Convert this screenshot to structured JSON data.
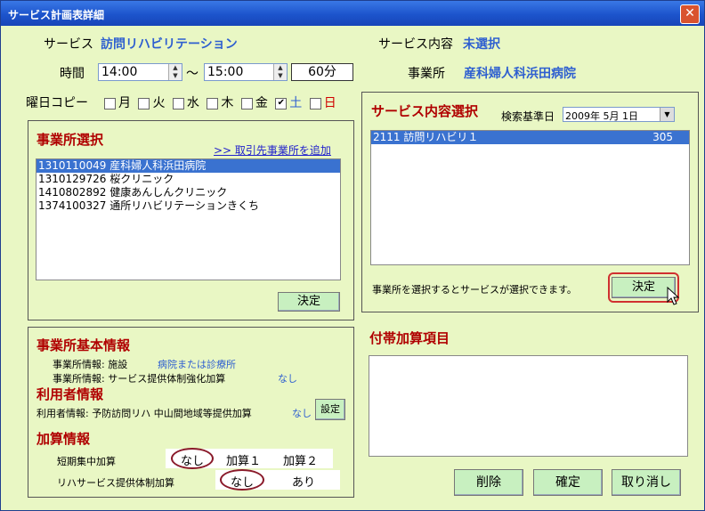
{
  "window": {
    "title": "サービス計画表詳細",
    "close_glyph": "✕"
  },
  "header": {
    "service_label": "サービス",
    "service_value": "訪問リハビリテーション",
    "content_label": "サービス内容",
    "content_value": "未選択",
    "time_label": "時間",
    "time_start": "14:00",
    "time_sep": "〜",
    "time_end": "15:00",
    "duration": "60分",
    "office_label": "事業所",
    "office_value": "産科婦人科浜田病院"
  },
  "weekday": {
    "label": "曜日コピー",
    "days": [
      {
        "label": "月",
        "checked": false,
        "color": "#000000"
      },
      {
        "label": "火",
        "checked": false,
        "color": "#000000"
      },
      {
        "label": "水",
        "checked": false,
        "color": "#000000"
      },
      {
        "label": "木",
        "checked": false,
        "color": "#000000"
      },
      {
        "label": "金",
        "checked": false,
        "color": "#000000"
      },
      {
        "label": "土",
        "checked": true,
        "color": "#2e5fd0"
      },
      {
        "label": "日",
        "checked": false,
        "color": "#d00000"
      }
    ]
  },
  "office_select": {
    "title": "事業所選択",
    "add_link": ">> 取引先事業所を追加",
    "items": [
      {
        "code": "1310110049",
        "name": "産科婦人科浜田病院",
        "selected": true
      },
      {
        "code": "1310129726",
        "name": "桜クリニック",
        "selected": false
      },
      {
        "code": "1410802892",
        "name": "健康あんしんクリニック",
        "selected": false
      },
      {
        "code": "1374100327",
        "name": "通所リハビリテーションきくち",
        "selected": false
      }
    ],
    "decide": "決定"
  },
  "service_select": {
    "title": "サービス内容選択",
    "date_label": "検索基準日",
    "date_value": "2009年 5月 1日",
    "items": [
      {
        "code": "2111",
        "name": "訪問リハビリ１",
        "units": "305",
        "selected": true
      }
    ],
    "hint": "事業所を選択するとサービスが選択できます。",
    "decide": "決定"
  },
  "office_info": {
    "title": "事業所基本情報",
    "line1_label": "事業所情報: 施設",
    "line1_value": "病院または診療所",
    "line2_label": "事業所情報: サービス提供体制強化加算",
    "line2_value": "なし"
  },
  "user_info": {
    "title": "利用者情報",
    "line_label": "利用者情報: 予防訪問リハ 中山間地域等提供加算",
    "line_value": "なし",
    "settings": "設定"
  },
  "addition": {
    "title": "加算情報",
    "row1_label": "短期集中加算",
    "row1_options": [
      "なし",
      "加算１",
      "加算２"
    ],
    "row2_label": "リハサービス提供体制加算",
    "row2_options": [
      "なし",
      "あり"
    ]
  },
  "extra": {
    "title": "付帯加算項目"
  },
  "buttons": {
    "delete": "削除",
    "confirm": "確定",
    "cancel": "取り消し"
  }
}
